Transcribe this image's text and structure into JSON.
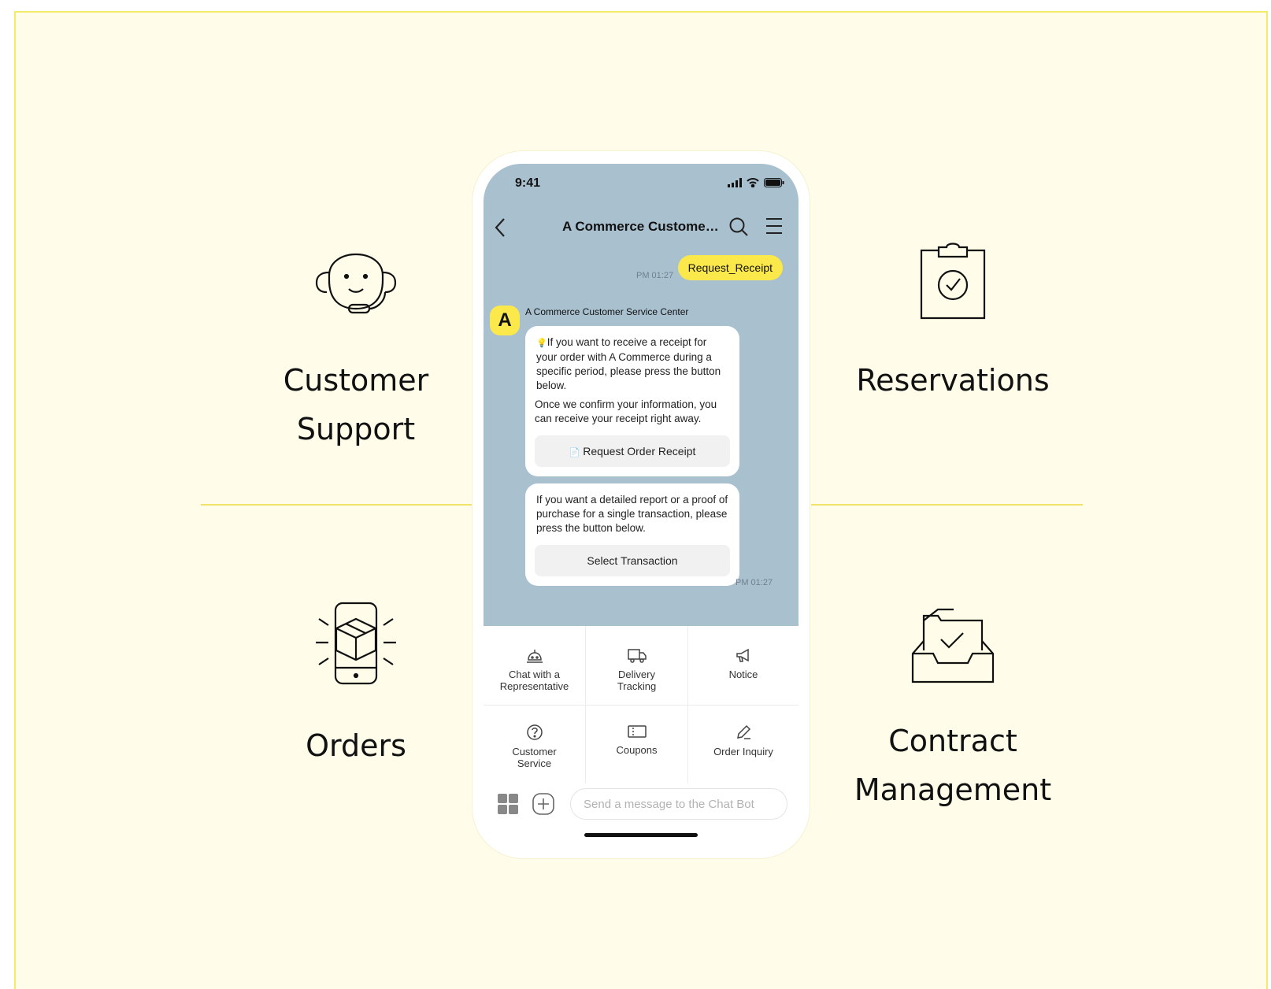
{
  "features": {
    "customer_support": {
      "label": "Customer\nSupport",
      "icon": "headset-agent-icon"
    },
    "reservations": {
      "label": "Reservations",
      "icon": "clipboard-check-icon"
    },
    "orders": {
      "label": "Orders",
      "icon": "phone-package-icon"
    },
    "contract_management": {
      "label": "Contract\nManagement",
      "icon": "inbox-folder-check-icon"
    }
  },
  "phone": {
    "status": {
      "time": "9:41"
    },
    "header": {
      "title": "A Commerce Customer..."
    },
    "messages": {
      "user_message": "Request_Receipt",
      "user_time": "PM 01:27",
      "sender_avatar": "A",
      "sender_name": "A Commerce Customer Service Center",
      "card1": {
        "text1": "If you want to receive a receipt for your order with A Commerce during a specific period, please press the button below.",
        "text2": "Once we confirm your information, you can receive your receipt right away.",
        "button": "Request Order Receipt"
      },
      "card2": {
        "text": "If you want a detailed report or a proof of purchase for a single transaction, please press the button below.",
        "button": "Select Transaction"
      },
      "bot_time": "PM 01:27"
    },
    "menu": [
      {
        "label": "Chat with a\nRepresentative",
        "icon": "service-bell-icon"
      },
      {
        "label": "Delivery\nTracking",
        "icon": "truck-icon"
      },
      {
        "label": "Notice",
        "icon": "megaphone-icon"
      },
      {
        "label": "Customer\nService",
        "icon": "question-circle-icon"
      },
      {
        "label": "Coupons",
        "icon": "coupon-icon"
      },
      {
        "label": "Order Inquiry",
        "icon": "pencil-icon"
      }
    ],
    "input": {
      "placeholder": "Send a message to the Chat Bot"
    }
  },
  "colors": {
    "accent_yellow": "#fbe84a",
    "chat_background": "#a9c0cf",
    "page_background": "#fffdea"
  }
}
